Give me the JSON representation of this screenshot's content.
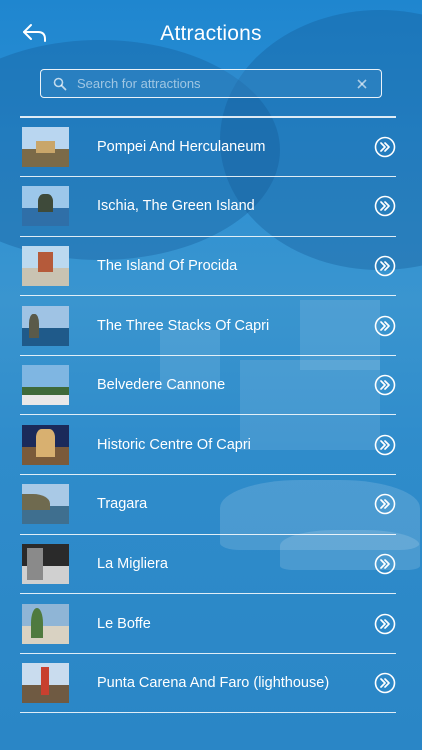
{
  "header": {
    "title": "Attractions"
  },
  "search": {
    "placeholder": "Search for attractions",
    "value": ""
  },
  "attractions": [
    {
      "label": "Pompei And Herculaneum",
      "thumb_sky": "#b9d6f0",
      "thumb_ground": "#7b6a48",
      "thumb_feat": "#c9a66a"
    },
    {
      "label": "Ischia, The Green Island",
      "thumb_sky": "#9cc7ea",
      "thumb_ground": "#2f6fa8",
      "thumb_feat": "#3e4a3a"
    },
    {
      "label": "The Island Of Procida",
      "thumb_sky": "#bcd9ef",
      "thumb_ground": "#c9c3b2",
      "thumb_feat": "#b55a3a"
    },
    {
      "label": "The Three Stacks Of Capri",
      "thumb_sky": "#9fc3e4",
      "thumb_ground": "#1f5a8a",
      "thumb_feat": "#5a5a4a"
    },
    {
      "label": "Belvedere Cannone",
      "thumb_sky": "#7fb6e2",
      "thumb_ground": "#e8e8e8",
      "thumb_feat": "#3f6a3a"
    },
    {
      "label": "Historic Centre Of Capri",
      "thumb_sky": "#1b2a5a",
      "thumb_ground": "#7a5a3a",
      "thumb_feat": "#d8b070"
    },
    {
      "label": "Tragara",
      "thumb_sky": "#a9c9e6",
      "thumb_ground": "#3f6f8f",
      "thumb_feat": "#6f6a4f"
    },
    {
      "label": "La Migliera",
      "thumb_sky": "#2a2a2a",
      "thumb_ground": "#d0d0d0",
      "thumb_feat": "#8a8a8a"
    },
    {
      "label": "Le Boffe",
      "thumb_sky": "#8fb5d6",
      "thumb_ground": "#d9d2c2",
      "thumb_feat": "#4f7a3f"
    },
    {
      "label": "Punta Carena And Faro (lighthouse)",
      "thumb_sky": "#c9dcee",
      "thumb_ground": "#6f5a42",
      "thumb_feat": "#c8402f"
    }
  ],
  "icons": {
    "back": "back-arrow-icon",
    "search": "search-icon",
    "clear": "clear-icon",
    "row_action": "double-chevron-right-icon"
  },
  "colors": {
    "accent": "#ffffff",
    "background": "#2a8fd4"
  }
}
